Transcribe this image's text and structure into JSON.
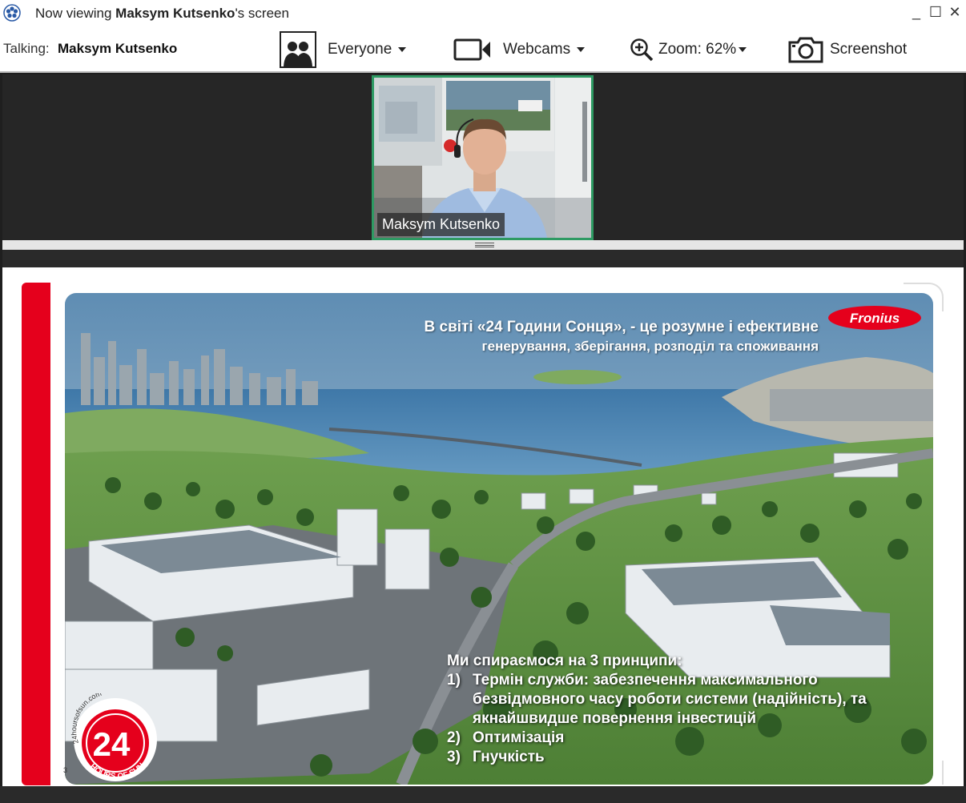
{
  "window": {
    "title_prefix": "Now viewing ",
    "title_name": "Maksym Kutsenko",
    "title_suffix": "'s screen",
    "controls": {
      "minimize": "_",
      "maximize": "☐",
      "close": "✕"
    }
  },
  "toolbar": {
    "talking_label": "Talking:",
    "talking_name": "Maksym Kutsenko",
    "everyone_label": "Everyone",
    "webcams_label": "Webcams",
    "zoom_label": "Zoom: 62%",
    "screenshot_label": "Screenshot"
  },
  "webcam": {
    "name": "Maksym Kutsenko",
    "accent": "#2e9a63"
  },
  "slide": {
    "headline_line1": "В світі «24 Години Сонця», - це розумне і ефективне",
    "headline_line2": "генерування, зберігання, розподіл та споживання",
    "logo_text": "Fronius",
    "principles_title": "Ми спираємося на 3 принципи:",
    "principles": [
      {
        "num": "1)",
        "text": "Термін служби: забезпечення максимального безвідмовного часу роботи системи (надійність), та якнайшвидше повернення інвестицій"
      },
      {
        "num": "2)",
        "text": "Оптимізація"
      },
      {
        "num": "3)",
        "text": "Гнучкість"
      }
    ],
    "badge": {
      "number": "24",
      "bottom_text": "HOURS OF SUN",
      "top_text": "24hoursofsun.com"
    },
    "page_number": "3",
    "accent": "#e5001c"
  }
}
